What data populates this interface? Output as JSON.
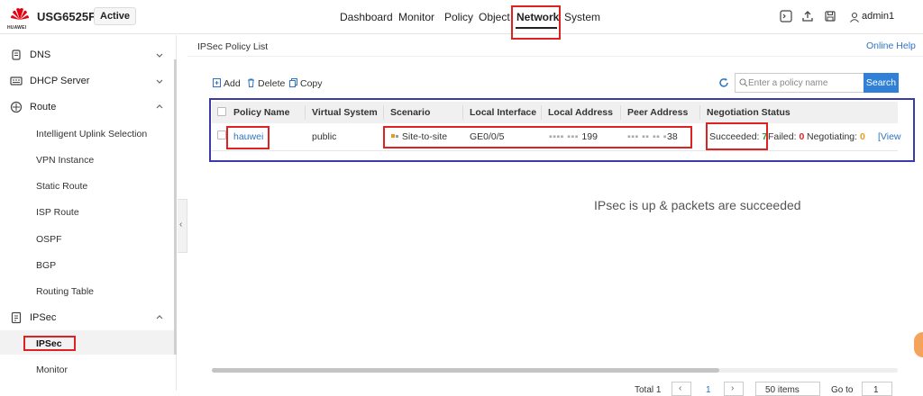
{
  "header": {
    "brand": "HUAWEI",
    "device": "USG6525F",
    "status_badge": "Active",
    "nav": [
      {
        "label": "Dashboard"
      },
      {
        "label": "Monitor"
      },
      {
        "label": "Policy"
      },
      {
        "label": "Object"
      },
      {
        "label": "Network"
      },
      {
        "label": "System"
      }
    ],
    "active_nav": "Network",
    "user": "admin1",
    "icons": [
      "terminal-icon",
      "upload-icon",
      "save-icon",
      "user-icon"
    ]
  },
  "sidebar": {
    "groups": [
      {
        "label": "DNS",
        "icon": "dns-icon",
        "expanded": false
      },
      {
        "label": "DHCP Server",
        "icon": "dhcp-icon",
        "expanded": false
      },
      {
        "label": "Route",
        "icon": "route-icon",
        "expanded": true
      },
      {
        "label": "IPSec",
        "icon": "ipsec-icon",
        "expanded": true
      }
    ],
    "route_items": [
      "Intelligent Uplink Selection",
      "VPN Instance",
      "Static Route",
      "ISP Route",
      "OSPF",
      "BGP",
      "Routing Table"
    ],
    "ipsec_items": [
      "IPSec",
      "Monitor"
    ],
    "selected_item": "IPSec"
  },
  "main": {
    "title": "IPSec Policy List",
    "online_help": "Online Help",
    "toolbar": {
      "add": "Add",
      "delete": "Delete",
      "copy": "Copy"
    },
    "search": {
      "placeholder": "Enter a policy name",
      "button": "Search"
    },
    "table": {
      "columns": [
        "Policy Name",
        "Virtual System",
        "Scenario",
        "Local Interface",
        "Local Address",
        "Peer Address",
        "Negotiation Status"
      ],
      "rows": [
        {
          "policy_name": "hauwei",
          "virtual_system": "public",
          "scenario": "Site-to-site",
          "local_interface": "GE0/0/5",
          "local_address_visible": "199",
          "peer_address_visible": "38",
          "status": {
            "succeeded_label": "Succeeded:",
            "succeeded": "7",
            "failed_label": "Failed:",
            "failed": "0",
            "negotiating_label": "Negotiating:",
            "negotiating": "0",
            "view": "[View"
          }
        }
      ]
    },
    "annotation": "IPsec is up & packets are succeeded",
    "pager": {
      "total": "Total 1",
      "page": "1",
      "page_size": "50 items",
      "goto": "Go to",
      "goto_value": "1"
    }
  },
  "colors": {
    "highlight_red": "#dd2222",
    "frame_blue": "#3a3aa8",
    "link_blue": "#2f73c4",
    "succeeded_green": "#2aa02a",
    "failed_red": "#dd2222",
    "negotiating_orange": "#e89a1b"
  }
}
